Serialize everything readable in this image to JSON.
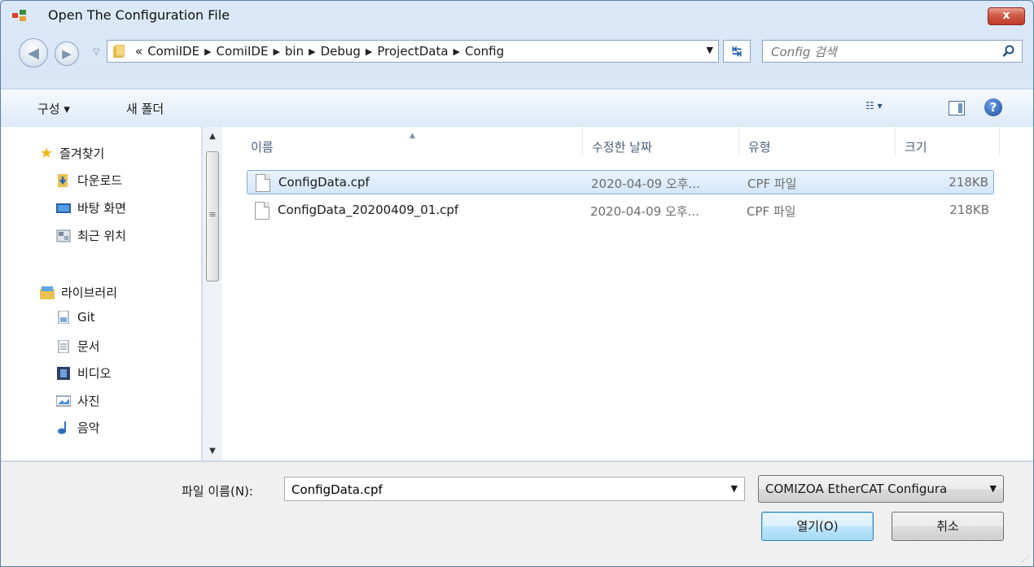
{
  "window": {
    "title": "Open The Configuration File",
    "close_label": "x"
  },
  "address": {
    "overflow": "«",
    "crumbs": [
      "ComiIDE",
      "ComiIDE",
      "bin",
      "Debug",
      "ProjectData",
      "Config"
    ]
  },
  "search": {
    "placeholder": "Config 검색"
  },
  "toolbar": {
    "organize_label": "구성 ▾",
    "new_folder_label": "새 폴더",
    "view_label": "☷ ▾",
    "help_label": "?"
  },
  "navpane": {
    "favorites": {
      "label": "즐겨찾기",
      "items": [
        {
          "label": "다운로드",
          "icon": "downloads-icon"
        },
        {
          "label": "바탕 화면",
          "icon": "desktop-icon"
        },
        {
          "label": "최근 위치",
          "icon": "recent-places-icon"
        }
      ]
    },
    "libraries": {
      "label": "라이브러리",
      "items": [
        {
          "label": "Git",
          "icon": "git-library-icon"
        },
        {
          "label": "문서",
          "icon": "documents-icon"
        },
        {
          "label": "비디오",
          "icon": "video-icon"
        },
        {
          "label": "사진",
          "icon": "pictures-icon"
        },
        {
          "label": "음악",
          "icon": "music-icon"
        }
      ]
    }
  },
  "filelist": {
    "columns": [
      "이름",
      "수정한 날짜",
      "유형",
      "크기"
    ],
    "files": [
      {
        "name": "ConfigData.cpf",
        "modified": "2020-04-09 오후...",
        "type": "CPF 파일",
        "size": "218KB",
        "selected": true
      },
      {
        "name": "ConfigData_20200409_01.cpf",
        "modified": "2020-04-09 오후...",
        "type": "CPF 파일",
        "size": "218KB",
        "selected": false
      }
    ]
  },
  "bottom": {
    "filename_label": "파일 이름(N):",
    "filename_value": "ConfigData.cpf",
    "filter_value": "COMIZOA EtherCAT Configura",
    "open_label": "열기(O)",
    "cancel_label": "취소"
  },
  "colors": {
    "selection_border": "#84acdd",
    "title_close": "#c0392b",
    "accent": "#3c7fb1"
  }
}
